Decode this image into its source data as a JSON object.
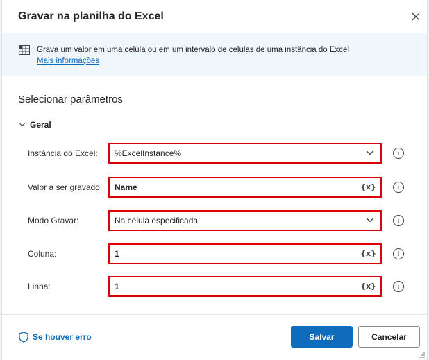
{
  "dialog": {
    "title": "Gravar na planilha do Excel",
    "close_icon": "close-icon"
  },
  "info": {
    "icon": "excel-icon",
    "text": "Grava um valor em uma célula ou em um intervalo de células de uma instância do Excel",
    "link": "Mais informações"
  },
  "section_title": "Selecionar parâmetros",
  "group": {
    "label": "Geral",
    "icon": "chevron-down-icon"
  },
  "fields": [
    {
      "label": "Instância do Excel:",
      "value": "%ExcelInstance%",
      "type": "dropdown"
    },
    {
      "label": "Valor a ser gravado:",
      "value": "Name",
      "type": "text",
      "var_label": "{x}"
    },
    {
      "label": "Modo Gravar:",
      "value": "Na célula especificada",
      "type": "dropdown"
    },
    {
      "label": "Coluna:",
      "value": "1",
      "type": "text",
      "var_label": "{x}"
    },
    {
      "label": "Linha:",
      "value": "1",
      "type": "text",
      "var_label": "{x}"
    }
  ],
  "help_glyph": "i",
  "footer": {
    "on_error": "Se houver erro",
    "save": "Salvar",
    "cancel": "Cancelar"
  },
  "colors": {
    "accent": "#0f6cbd",
    "highlight_border": "#d9000a",
    "info_bg": "#eff6fc"
  }
}
